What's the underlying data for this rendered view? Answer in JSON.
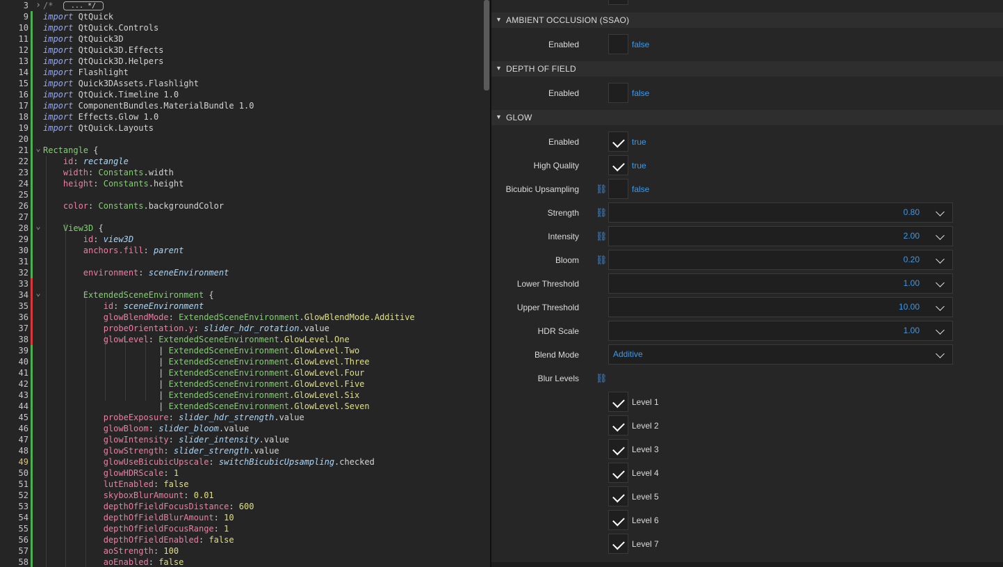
{
  "editor": {
    "gutter_numbers": [
      3,
      9,
      10,
      11,
      12,
      13,
      14,
      15,
      16,
      17,
      18,
      19,
      20,
      21,
      22,
      23,
      24,
      25,
      26,
      27,
      28,
      29,
      30,
      31,
      32,
      33,
      34,
      35,
      36,
      37,
      38,
      39,
      40,
      41,
      42,
      43,
      44,
      45,
      46,
      47,
      48,
      49,
      50,
      51,
      52,
      53,
      54,
      55,
      56,
      57,
      58
    ],
    "current_line": 49,
    "collapsed_comment": {
      "prefix": "/*",
      "placeholder": "... */"
    },
    "lines": [
      {
        "t": [
          [
            "kw",
            "import"
          ],
          [
            "mod",
            " QtQuick"
          ]
        ]
      },
      {
        "t": [
          [
            "kw",
            "import"
          ],
          [
            "mod",
            " QtQuick.Controls"
          ]
        ]
      },
      {
        "t": [
          [
            "kw",
            "import"
          ],
          [
            "mod",
            " QtQuick3D"
          ]
        ]
      },
      {
        "t": [
          [
            "kw",
            "import"
          ],
          [
            "mod",
            " QtQuick3D.Effects"
          ]
        ]
      },
      {
        "t": [
          [
            "kw",
            "import"
          ],
          [
            "mod",
            " QtQuick3D.Helpers"
          ]
        ]
      },
      {
        "t": [
          [
            "kw",
            "import"
          ],
          [
            "mod",
            " Flashlight"
          ]
        ]
      },
      {
        "t": [
          [
            "kw",
            "import"
          ],
          [
            "mod",
            " Quick3DAssets.Flashlight"
          ]
        ]
      },
      {
        "t": [
          [
            "kw",
            "import"
          ],
          [
            "mod",
            " QtQuick.Timeline 1.0"
          ]
        ]
      },
      {
        "t": [
          [
            "kw",
            "import"
          ],
          [
            "mod",
            " ComponentBundles.MaterialBundle 1.0"
          ]
        ]
      },
      {
        "t": [
          [
            "kw",
            "import"
          ],
          [
            "mod",
            " Effects.Glow 1.0"
          ]
        ]
      },
      {
        "t": [
          [
            "kw",
            "import"
          ],
          [
            "mod",
            " QtQuick.Layouts"
          ]
        ]
      },
      {
        "t": []
      },
      {
        "t": [
          [
            "ty",
            "Rectangle"
          ],
          [
            "plain",
            " {"
          ]
        ]
      },
      {
        "t": [
          [
            "plain",
            "    "
          ],
          [
            "prop",
            "id"
          ],
          [
            "plain",
            ": "
          ],
          [
            "id",
            "rectangle"
          ]
        ]
      },
      {
        "t": [
          [
            "plain",
            "    "
          ],
          [
            "prop",
            "width"
          ],
          [
            "plain",
            ": "
          ],
          [
            "en",
            "Constants"
          ],
          [
            "plain",
            ".width"
          ]
        ]
      },
      {
        "t": [
          [
            "plain",
            "    "
          ],
          [
            "prop",
            "height"
          ],
          [
            "plain",
            ": "
          ],
          [
            "en",
            "Constants"
          ],
          [
            "plain",
            ".height"
          ]
        ]
      },
      {
        "t": []
      },
      {
        "t": [
          [
            "plain",
            "    "
          ],
          [
            "prop",
            "color"
          ],
          [
            "plain",
            ": "
          ],
          [
            "en",
            "Constants"
          ],
          [
            "plain",
            ".backgroundColor"
          ]
        ]
      },
      {
        "t": []
      },
      {
        "t": [
          [
            "plain",
            "    "
          ],
          [
            "ty",
            "View3D"
          ],
          [
            "plain",
            " {"
          ]
        ]
      },
      {
        "t": [
          [
            "plain",
            "        "
          ],
          [
            "prop",
            "id"
          ],
          [
            "plain",
            ": "
          ],
          [
            "id",
            "view3D"
          ]
        ]
      },
      {
        "t": [
          [
            "plain",
            "        "
          ],
          [
            "prop",
            "anchors.fill"
          ],
          [
            "plain",
            ": "
          ],
          [
            "id",
            "parent"
          ]
        ]
      },
      {
        "t": []
      },
      {
        "t": [
          [
            "plain",
            "        "
          ],
          [
            "prop",
            "environment"
          ],
          [
            "plain",
            ": "
          ],
          [
            "id",
            "sceneEnvironment"
          ]
        ]
      },
      {
        "t": []
      },
      {
        "t": [
          [
            "plain",
            "        "
          ],
          [
            "ty",
            "ExtendedSceneEnvironment"
          ],
          [
            "plain",
            " {"
          ]
        ]
      },
      {
        "t": [
          [
            "plain",
            "            "
          ],
          [
            "prop",
            "id"
          ],
          [
            "plain",
            ": "
          ],
          [
            "id",
            "sceneEnvironment"
          ]
        ]
      },
      {
        "t": [
          [
            "plain",
            "            "
          ],
          [
            "prop",
            "glowBlendMode"
          ],
          [
            "plain",
            ": "
          ],
          [
            "en",
            "ExtendedSceneEnvironment"
          ],
          [
            "plain",
            "."
          ],
          [
            "fld",
            "GlowBlendMode.Additive"
          ]
        ]
      },
      {
        "t": [
          [
            "plain",
            "            "
          ],
          [
            "prop",
            "probeOrientation.y"
          ],
          [
            "plain",
            ": "
          ],
          [
            "id",
            "slider_hdr_rotation"
          ],
          [
            "plain",
            ".value"
          ]
        ]
      },
      {
        "t": [
          [
            "plain",
            "            "
          ],
          [
            "prop",
            "glowLevel"
          ],
          [
            "plain",
            ": "
          ],
          [
            "en",
            "ExtendedSceneEnvironment"
          ],
          [
            "plain",
            "."
          ],
          [
            "fld",
            "GlowLevel.One"
          ]
        ]
      },
      {
        "t": [
          [
            "plain",
            "                       | "
          ],
          [
            "en",
            "ExtendedSceneEnvironment"
          ],
          [
            "plain",
            "."
          ],
          [
            "fld",
            "GlowLevel.Two"
          ]
        ]
      },
      {
        "t": [
          [
            "plain",
            "                       | "
          ],
          [
            "en",
            "ExtendedSceneEnvironment"
          ],
          [
            "plain",
            "."
          ],
          [
            "fld",
            "GlowLevel.Three"
          ]
        ]
      },
      {
        "t": [
          [
            "plain",
            "                       | "
          ],
          [
            "en",
            "ExtendedSceneEnvironment"
          ],
          [
            "plain",
            "."
          ],
          [
            "fld",
            "GlowLevel.Four"
          ]
        ]
      },
      {
        "t": [
          [
            "plain",
            "                       | "
          ],
          [
            "en",
            "ExtendedSceneEnvironment"
          ],
          [
            "plain",
            "."
          ],
          [
            "fld",
            "GlowLevel.Five"
          ]
        ]
      },
      {
        "t": [
          [
            "plain",
            "                       | "
          ],
          [
            "en",
            "ExtendedSceneEnvironment"
          ],
          [
            "plain",
            "."
          ],
          [
            "fld",
            "GlowLevel.Six"
          ]
        ]
      },
      {
        "t": [
          [
            "plain",
            "                       | "
          ],
          [
            "en",
            "ExtendedSceneEnvironment"
          ],
          [
            "plain",
            "."
          ],
          [
            "fld",
            "GlowLevel.Seven"
          ]
        ]
      },
      {
        "t": [
          [
            "plain",
            "            "
          ],
          [
            "prop",
            "probeExposure"
          ],
          [
            "plain",
            ": "
          ],
          [
            "id",
            "slider_hdr_strength"
          ],
          [
            "plain",
            ".value"
          ]
        ]
      },
      {
        "t": [
          [
            "plain",
            "            "
          ],
          [
            "prop",
            "glowBloom"
          ],
          [
            "plain",
            ": "
          ],
          [
            "id",
            "slider_bloom"
          ],
          [
            "plain",
            ".value"
          ]
        ]
      },
      {
        "t": [
          [
            "plain",
            "            "
          ],
          [
            "prop",
            "glowIntensity"
          ],
          [
            "plain",
            ": "
          ],
          [
            "id",
            "slider_intensity"
          ],
          [
            "plain",
            ".value"
          ]
        ]
      },
      {
        "t": [
          [
            "plain",
            "            "
          ],
          [
            "prop",
            "glowStrength"
          ],
          [
            "plain",
            ": "
          ],
          [
            "id",
            "slider_strength"
          ],
          [
            "plain",
            ".value"
          ]
        ]
      },
      {
        "t": [
          [
            "plain",
            "            "
          ],
          [
            "prop",
            "glowUseBicubicUpscale"
          ],
          [
            "plain",
            ": "
          ],
          [
            "id",
            "switchBicubicUpsampling"
          ],
          [
            "plain",
            ".checked"
          ]
        ]
      },
      {
        "t": [
          [
            "plain",
            "            "
          ],
          [
            "prop",
            "glowHDRScale"
          ],
          [
            "plain",
            ": "
          ],
          [
            "num",
            "1"
          ]
        ]
      },
      {
        "t": [
          [
            "plain",
            "            "
          ],
          [
            "prop",
            "lutEnabled"
          ],
          [
            "plain",
            ": "
          ],
          [
            "num",
            "false"
          ]
        ]
      },
      {
        "t": [
          [
            "plain",
            "            "
          ],
          [
            "prop",
            "skyboxBlurAmount"
          ],
          [
            "plain",
            ": "
          ],
          [
            "num",
            "0.01"
          ]
        ]
      },
      {
        "t": [
          [
            "plain",
            "            "
          ],
          [
            "prop",
            "depthOfFieldFocusDistance"
          ],
          [
            "plain",
            ": "
          ],
          [
            "num",
            "600"
          ]
        ]
      },
      {
        "t": [
          [
            "plain",
            "            "
          ],
          [
            "prop",
            "depthOfFieldBlurAmount"
          ],
          [
            "plain",
            ": "
          ],
          [
            "num",
            "10"
          ]
        ]
      },
      {
        "t": [
          [
            "plain",
            "            "
          ],
          [
            "prop",
            "depthOfFieldFocusRange"
          ],
          [
            "plain",
            ": "
          ],
          [
            "num",
            "1"
          ]
        ]
      },
      {
        "t": [
          [
            "plain",
            "            "
          ],
          [
            "prop",
            "depthOfFieldEnabled"
          ],
          [
            "plain",
            ": "
          ],
          [
            "num",
            "false"
          ]
        ]
      },
      {
        "t": [
          [
            "plain",
            "            "
          ],
          [
            "prop",
            "aoStrength"
          ],
          [
            "plain",
            ": "
          ],
          [
            "num",
            "100"
          ]
        ]
      },
      {
        "t": [
          [
            "plain",
            "            "
          ],
          [
            "prop",
            "aoEnabled"
          ],
          [
            "plain",
            ": "
          ],
          [
            "num",
            "false"
          ]
        ]
      }
    ],
    "change_markers": {
      "green": [
        9,
        10,
        11,
        12,
        13,
        14,
        15,
        16,
        17,
        18,
        19,
        20,
        21,
        22,
        23,
        24,
        25,
        26,
        27,
        28,
        29,
        30,
        31,
        32,
        39,
        40,
        41,
        42,
        43,
        44,
        45,
        46,
        47,
        48,
        49,
        50,
        51,
        52,
        53,
        54,
        55,
        56,
        57,
        58
      ],
      "red": [
        33,
        34,
        35,
        36,
        37,
        38
      ]
    },
    "fold_lines": [
      21,
      28,
      34
    ]
  },
  "properties": {
    "ssao": {
      "title": "AMBIENT OCCLUSION (SSAO)",
      "enabled_label": "Enabled",
      "enabled_value": "false"
    },
    "dof": {
      "title": "DEPTH OF FIELD",
      "enabled_label": "Enabled",
      "enabled_value": "false"
    },
    "glow": {
      "title": "GLOW",
      "enabled_label": "Enabled",
      "enabled_value": "true",
      "hq_label": "High Quality",
      "hq_value": "true",
      "bicubic_label": "Bicubic Upsampling",
      "bicubic_value": "false",
      "strength_label": "Strength",
      "strength_value": "0.80",
      "intensity_label": "Intensity",
      "intensity_value": "2.00",
      "bloom_label": "Bloom",
      "bloom_value": "0.20",
      "lower_label": "Lower Threshold",
      "lower_value": "1.00",
      "upper_label": "Upper Threshold",
      "upper_value": "10.00",
      "hdr_label": "HDR Scale",
      "hdr_value": "1.00",
      "blend_label": "Blend Mode",
      "blend_value": "Additive",
      "blur_label": "Blur Levels",
      "levels": [
        "Level 1",
        "Level 2",
        "Level 3",
        "Level 4",
        "Level 5",
        "Level 6",
        "Level 7"
      ]
    }
  },
  "colors": {
    "accent_blue": "#3d9ae8",
    "link_blue": "#3d8ee0",
    "marker_green": "#4caf50",
    "marker_red": "#d9363e"
  }
}
